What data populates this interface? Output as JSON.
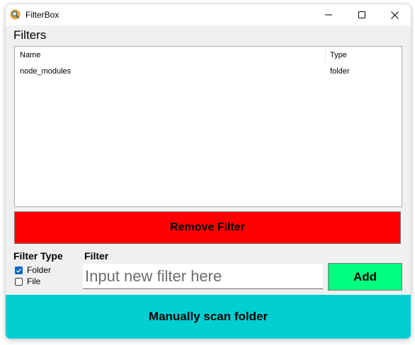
{
  "window": {
    "title": "FilterBox",
    "app_icon": "magnifier-icon"
  },
  "filters_section": {
    "heading": "Filters",
    "columns": [
      "Name",
      "Type"
    ],
    "rows": [
      {
        "name": "node_modules",
        "type": "folder"
      }
    ]
  },
  "remove_button": "Remove Filter",
  "filter_type": {
    "heading": "Filter Type",
    "options": [
      {
        "label": "Folder",
        "checked": true
      },
      {
        "label": "File",
        "checked": false
      }
    ]
  },
  "filter_entry": {
    "heading": "Filter",
    "value": "",
    "placeholder": "Input new filter here"
  },
  "add_button": "Add",
  "scan_button": "Manually scan folder",
  "colors": {
    "remove": "#ff0000",
    "add": "#00ff7f",
    "scan": "#00ced1",
    "checkbox_accent": "#0067c0"
  }
}
